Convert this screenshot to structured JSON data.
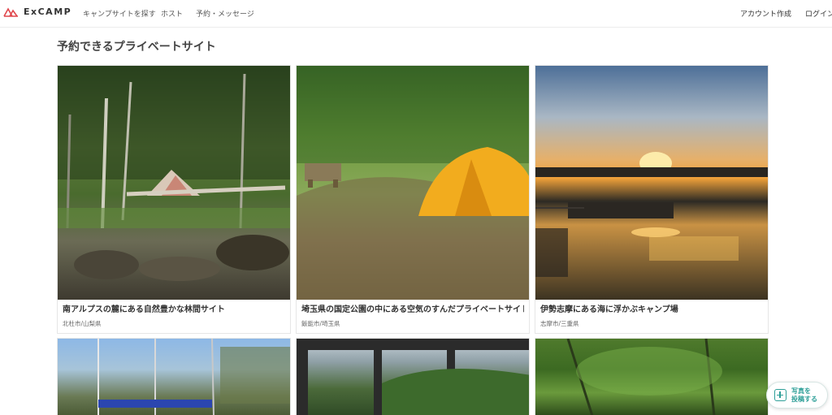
{
  "brand": {
    "name": "ExCAMP",
    "accent": "#e0474c"
  },
  "nav": {
    "items": [
      {
        "label": "キャンプサイトを探す"
      },
      {
        "label": "ホスト"
      },
      {
        "label": "予約・メッセージ"
      }
    ],
    "signup": "アカウント作成",
    "login": "ログイン"
  },
  "section": {
    "title": "予約できるプライベートサイト"
  },
  "cards": [
    {
      "name": "南アルプスの麓にある自然豊かな林間サイト",
      "location": "北杜市/山梨県"
    },
    {
      "name": "埼玉県の国定公園の中にある空気のすんだプライベートサイト",
      "location": "飯能市/埼玉県"
    },
    {
      "name": "伊勢志摩にある海に浮かぶキャンプ場",
      "location": "志摩市/三重県"
    },
    {
      "name": "",
      "location": ""
    },
    {
      "name": "",
      "location": ""
    },
    {
      "name": "",
      "location": ""
    }
  ],
  "fab": {
    "label": "写真を\n投稿する",
    "color": "#2e9f98"
  }
}
